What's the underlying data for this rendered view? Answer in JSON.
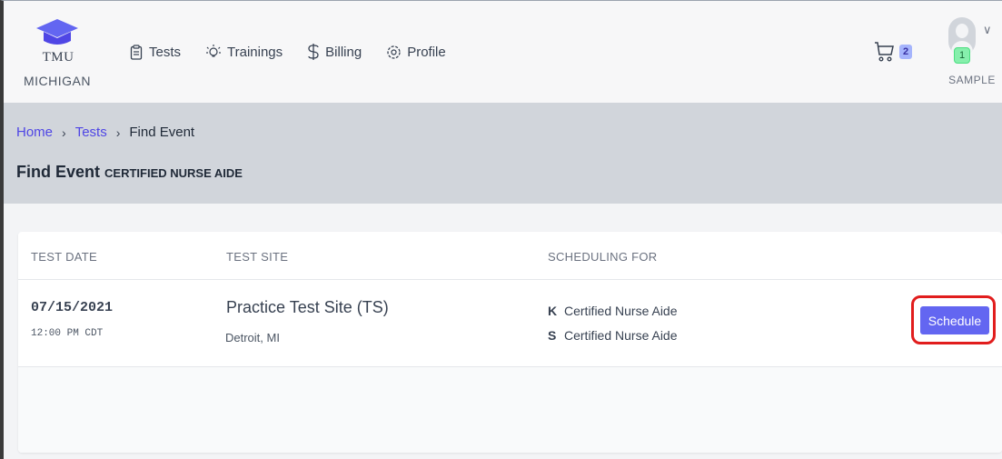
{
  "brand": {
    "line1": "TMU",
    "line2": "MICHIGAN"
  },
  "nav": {
    "tests": "Tests",
    "trainings": "Trainings",
    "billing": "Billing",
    "profile": "Profile"
  },
  "cart": {
    "count": "2"
  },
  "user": {
    "badge": "1",
    "name": "SAMPLE"
  },
  "breadcrumb": {
    "home": "Home",
    "tests": "Tests",
    "current": "Find Event",
    "separator": "›"
  },
  "page": {
    "title": "Find Event",
    "subtitle": "CERTIFIED NURSE AIDE"
  },
  "table": {
    "headers": {
      "date": "TEST DATE",
      "site": "TEST SITE",
      "scheduling": "SCHEDULING FOR"
    },
    "rows": [
      {
        "date": "07/15/2021",
        "time": "12:00 PM CDT",
        "site": "Practice Test Site (TS)",
        "city": "Detroit, MI",
        "scheduling": [
          {
            "code": "K",
            "label": "Certified Nurse Aide"
          },
          {
            "code": "S",
            "label": "Certified Nurse Aide"
          }
        ],
        "action": "Schedule"
      }
    ]
  },
  "colors": {
    "accent": "#6366f1",
    "link": "#4f46e5",
    "highlight": "#e11d1d"
  }
}
